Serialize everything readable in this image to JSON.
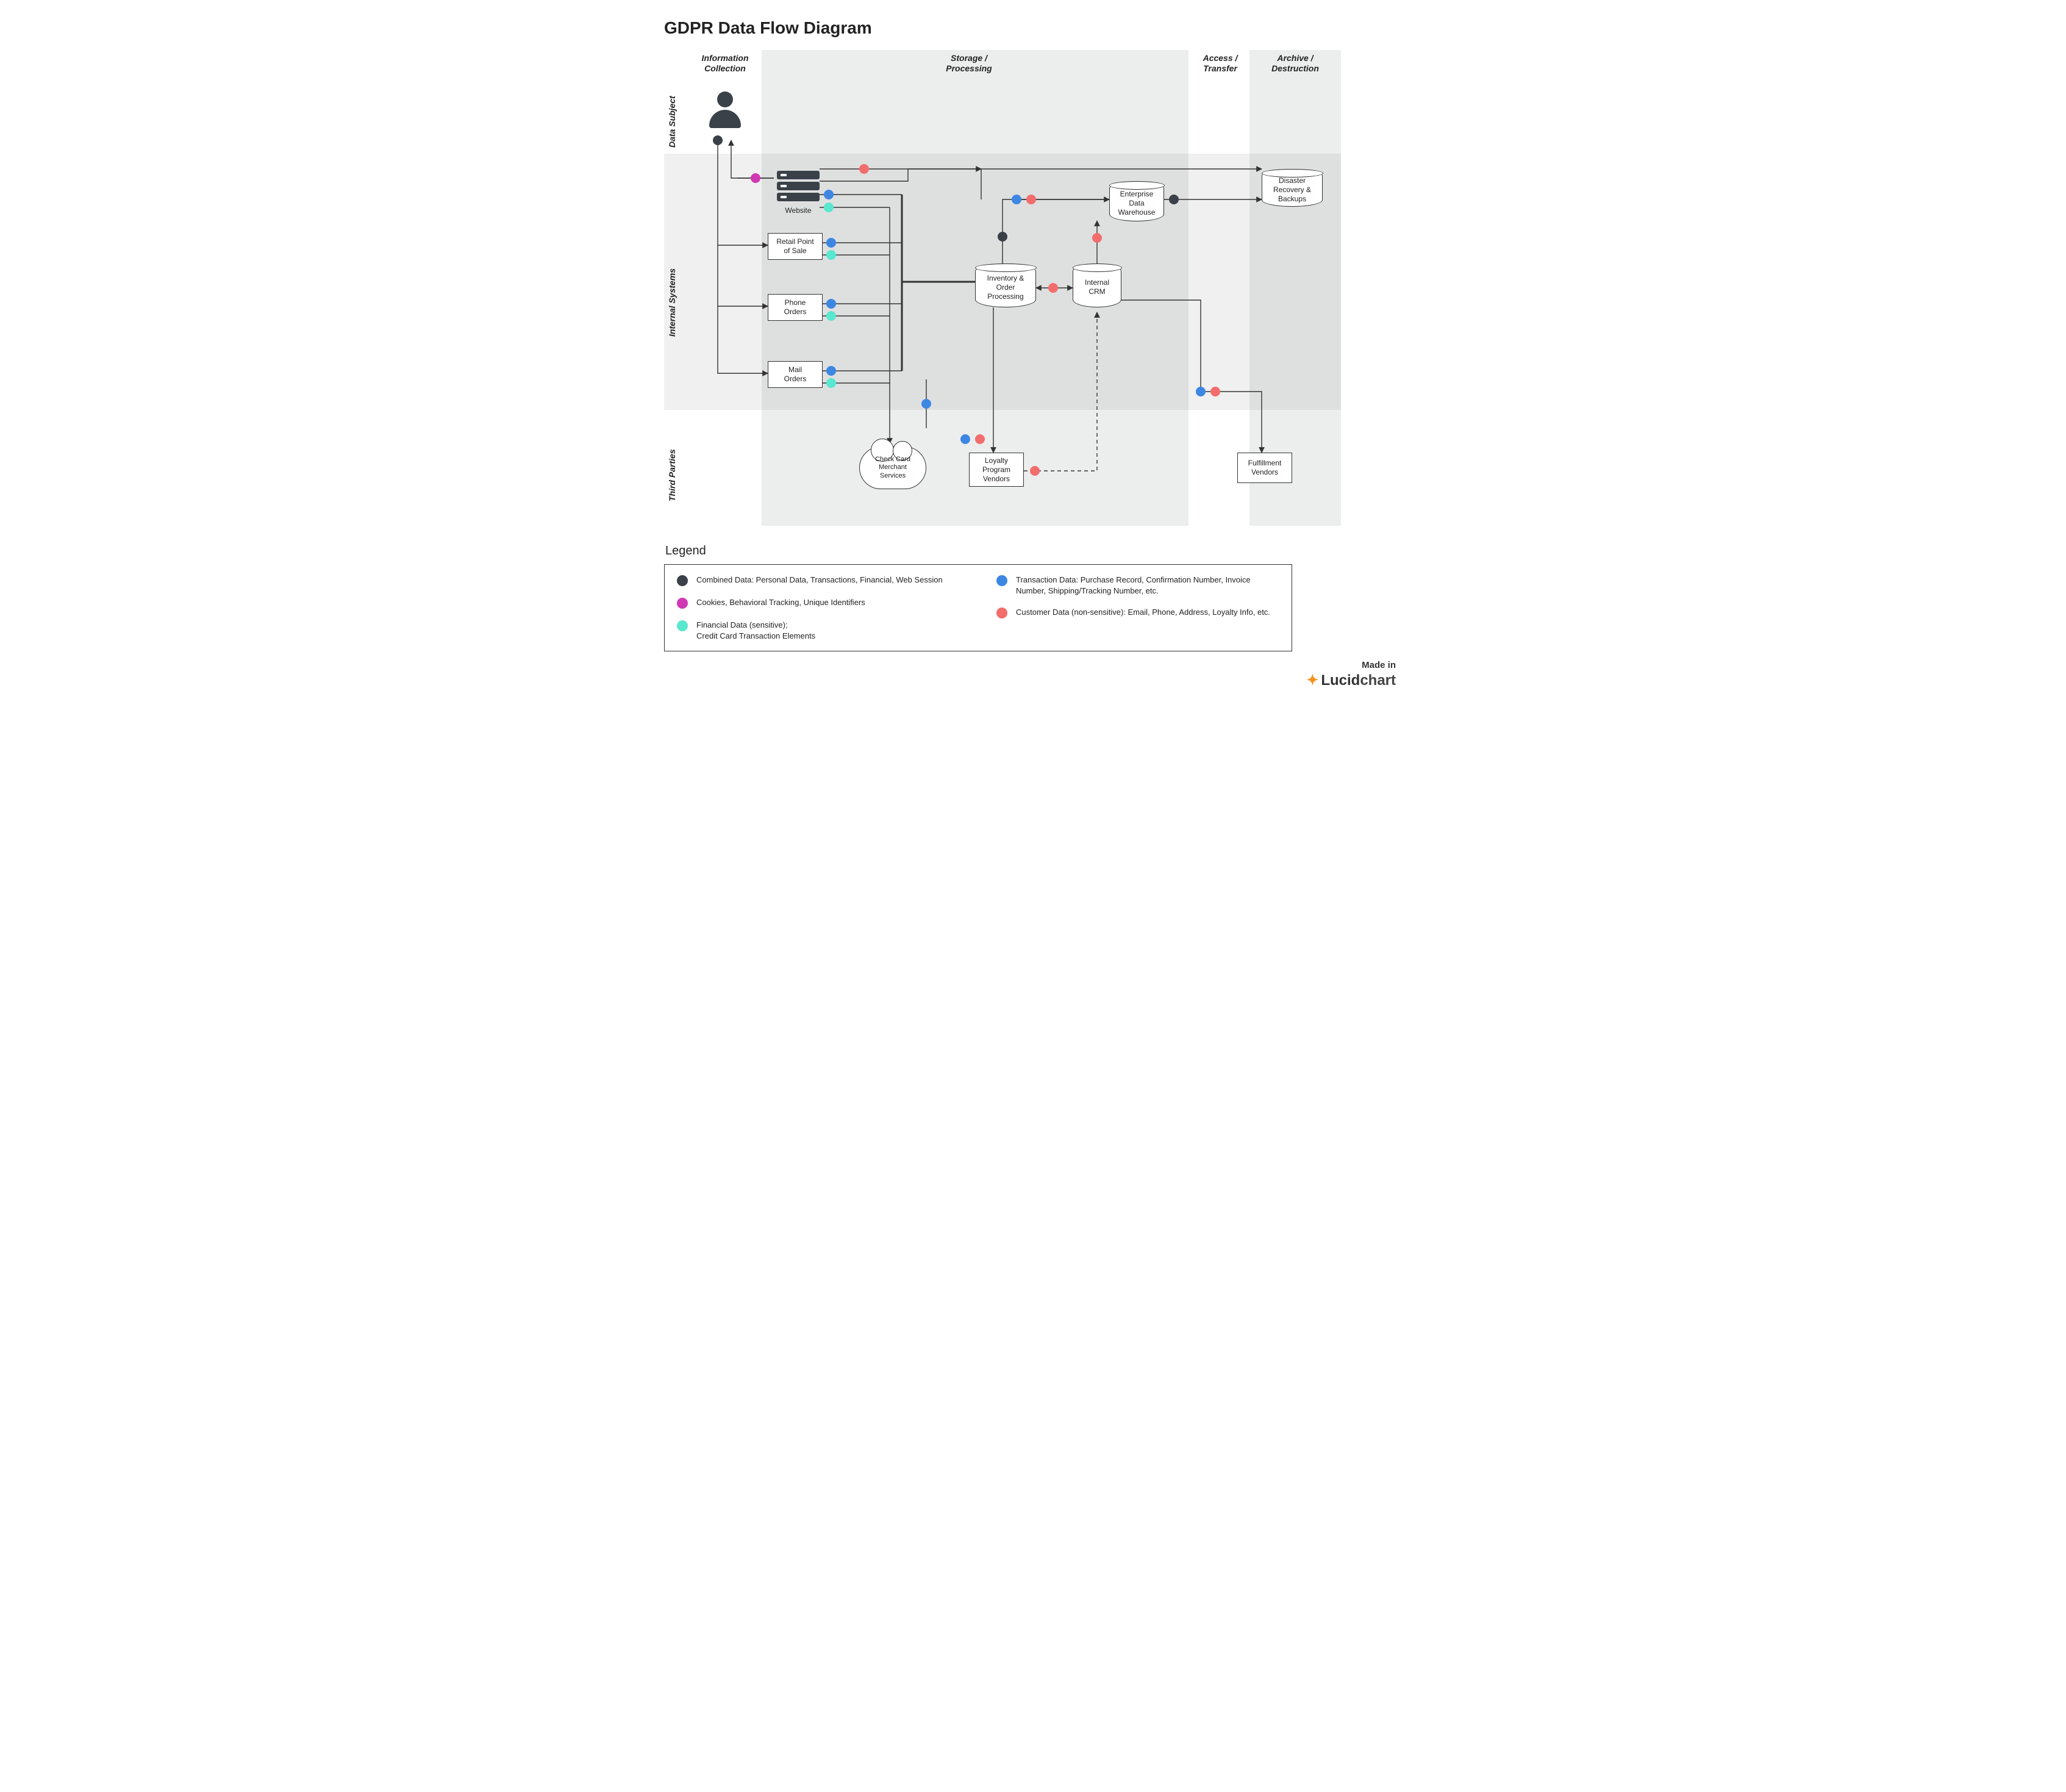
{
  "title": "GDPR Data Flow Diagram",
  "columns": {
    "info": "Information\nCollection",
    "storage": "Storage /\nProcessing",
    "access": "Access /\nTransfer",
    "archive": "Archive /\nDestruction"
  },
  "rows": {
    "subject": "Data Subject",
    "internal": "Internal Systems",
    "third": "Third Parties"
  },
  "nodes": {
    "website": "Website",
    "retail": "Retail Point\nof Sale",
    "phone": "Phone\nOrders",
    "mail": "Mail\nOrders",
    "merchant": "Check Card\nMerchant\nServices",
    "loyalty": "Loyalty\nProgram\nVendors",
    "fulfillment": "Fulfillment\nVendors",
    "inventory": "Inventory &\nOrder\nProcessing",
    "crm": "Internal\nCRM",
    "edw": "Enterprise\nData\nWarehouse",
    "backup": "Disaster\nRecovery &\nBackups"
  },
  "legend": {
    "title": "Legend",
    "items": {
      "combined": "Combined Data: Personal Data, Transactions, Financial, Web Session",
      "cookies": "Cookies, Behavioral Tracking, Unique Identifiers",
      "financial": "Financial Data (sensitive);\nCredit Card Transaction Elements",
      "transaction": "Transaction Data: Purchase Record, Confirmation Number, Invoice Number, Shipping/Tracking Number, etc.",
      "customer": "Customer Data (non-sensitive): Email, Phone, Address, Loyalty Info, etc."
    }
  },
  "brand": {
    "made": "Made in",
    "name_bold": "Lucid",
    "name_rest": "chart"
  }
}
